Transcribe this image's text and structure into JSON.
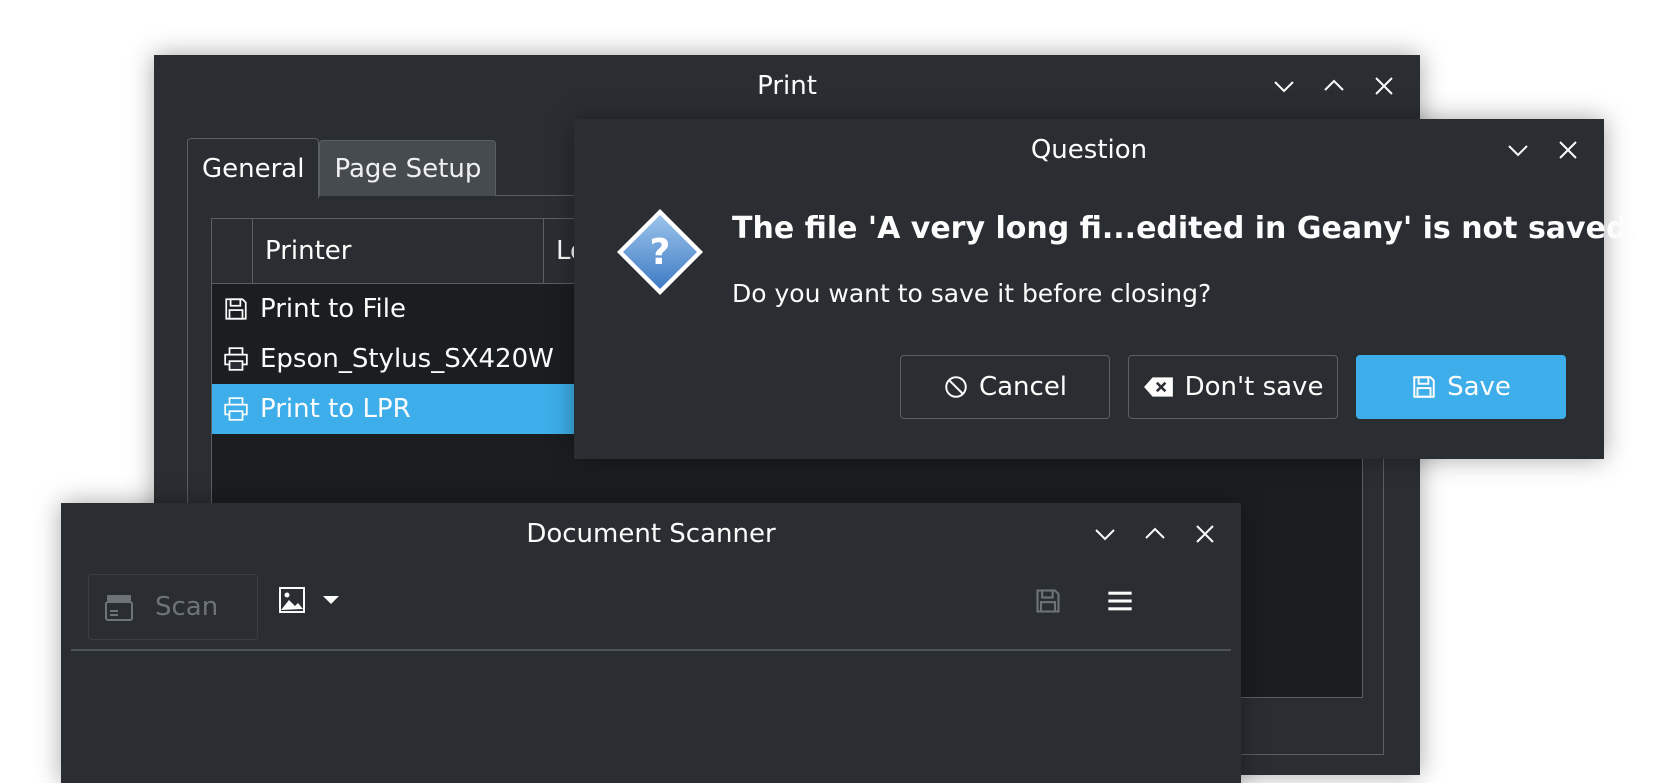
{
  "print_window": {
    "title": "Print",
    "tabs": [
      "General",
      "Page Setup"
    ],
    "table": {
      "headers": [
        "Printer",
        "Lo"
      ],
      "rows": [
        {
          "name": "Print to File",
          "icon": "save-icon",
          "selected": false
        },
        {
          "name": "Epson_Stylus_SX420W",
          "icon": "printer-icon",
          "selected": false
        },
        {
          "name": "Print to LPR",
          "icon": "printer-icon",
          "selected": true
        }
      ]
    }
  },
  "question_dialog": {
    "title": "Question",
    "heading": "The file 'A very long fi...edited in Geany' is not saved.",
    "message": "Do you want to save it before closing?",
    "buttons": {
      "cancel": "Cancel",
      "dont_save": "Don't save",
      "save": "Save"
    }
  },
  "scanner_window": {
    "title": "Document Scanner",
    "scan_label": "Scan"
  },
  "colors": {
    "window_bg": "#2a2e32",
    "accent": "#3daee9",
    "text": "#fcfcfc"
  }
}
